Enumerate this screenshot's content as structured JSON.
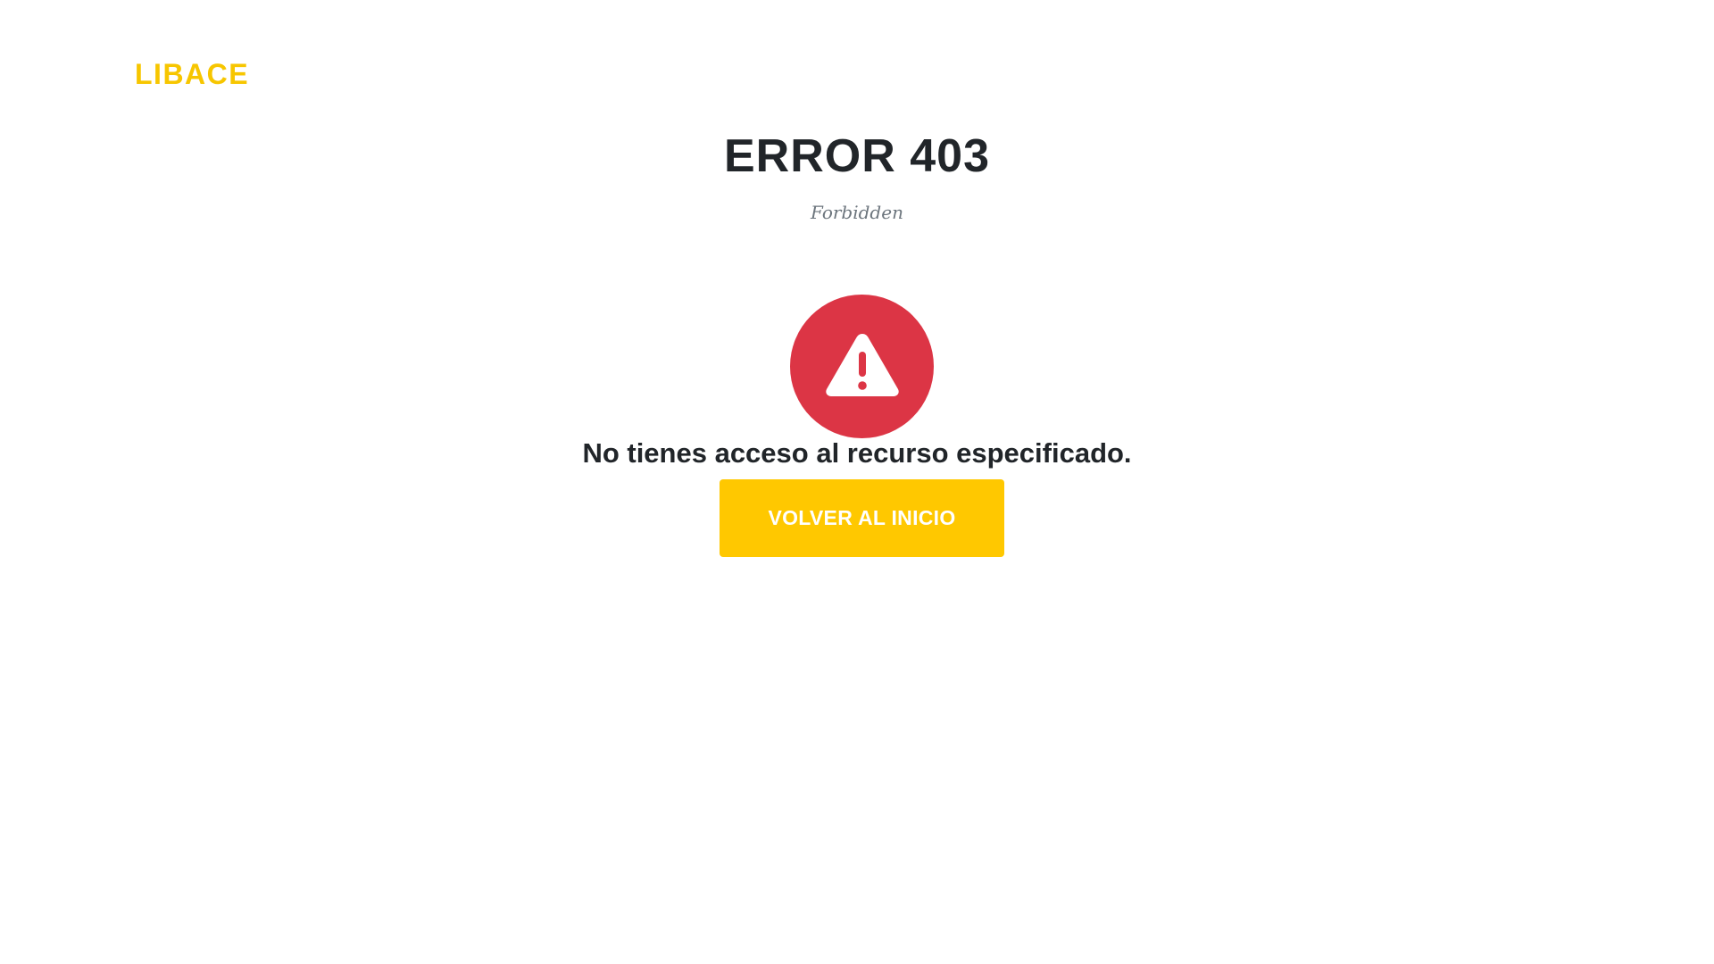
{
  "brand": {
    "name": "LIBACE",
    "color": "#f7c600"
  },
  "error": {
    "title": "ERROR 403",
    "subtitle": "Forbidden",
    "icon": "warning-triangle-icon",
    "icon_background": "#dc3545",
    "message": "No tienes acceso al recurso especificado."
  },
  "action": {
    "home_label": "VOLVER AL INICIO",
    "button_color": "#ffc800"
  }
}
